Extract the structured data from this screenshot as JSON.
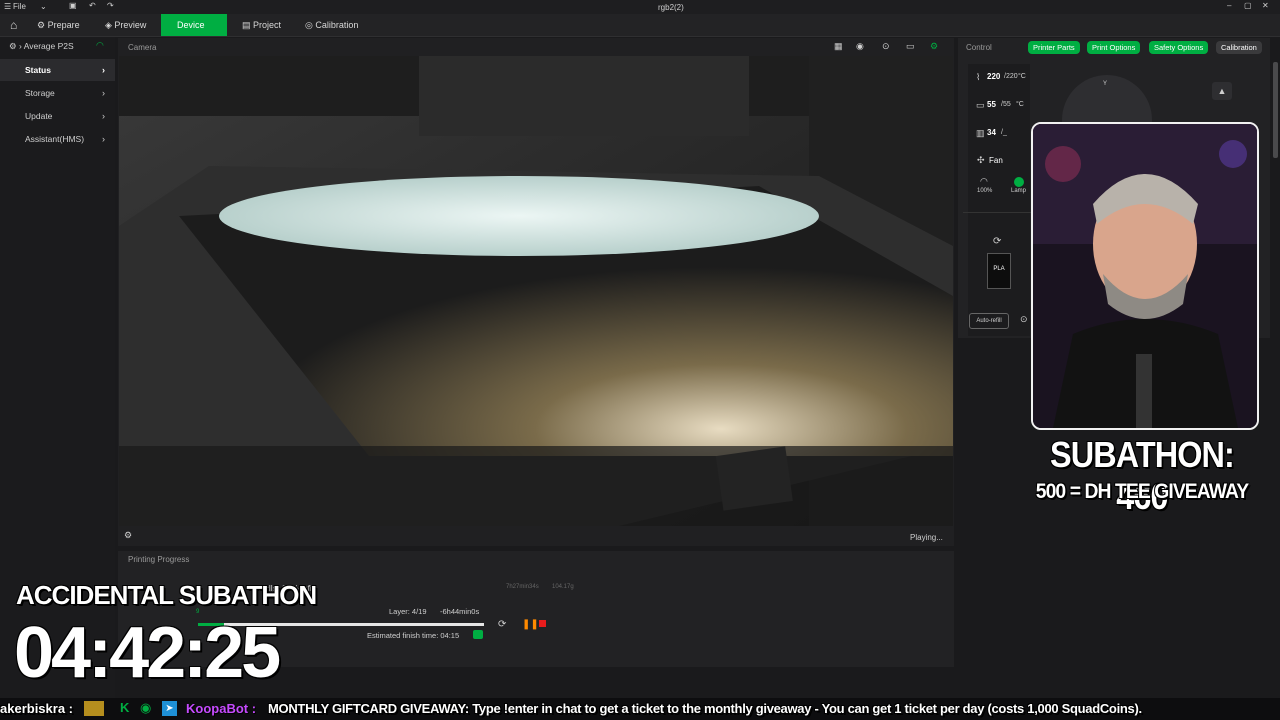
{
  "titlebar": {
    "file_menu": "File",
    "window_title": "rgb2(2)"
  },
  "tabs": [
    {
      "label": "Prepare"
    },
    {
      "label": "Preview"
    },
    {
      "label": "Device"
    },
    {
      "label": "Project"
    },
    {
      "label": "Calibration"
    }
  ],
  "sidebar": {
    "printer_name": "Average P2S",
    "items": [
      {
        "label": "Status"
      },
      {
        "label": "Storage"
      },
      {
        "label": "Update"
      },
      {
        "label": "Assistant(HMS)"
      }
    ]
  },
  "camera": {
    "title": "Camera",
    "status": "Playing..."
  },
  "progress": {
    "title": "Printing Progress",
    "job_info": "walls, 15% infill",
    "time_info": "7h27min34s",
    "weight_info": "104.17g",
    "layer": "Layer: 4/19",
    "remaining": "-6h44min0s",
    "finish_time": "Estimated finish time: 04:15",
    "percent": "9",
    "progress_fraction": 0.09
  },
  "control": {
    "title": "Control",
    "buttons": [
      "Printer Parts",
      "Print Options",
      "Safety Options",
      "Calibration"
    ],
    "nozzle_temp": "220",
    "nozzle_target": "/220",
    "bed_temp": "55",
    "bed_target": "/55",
    "chamber_temp": "34",
    "chamber_target": "/_",
    "unit": "°C",
    "fan_label": "Fan",
    "fan_speed": "100%",
    "lamp_label": "Lamp",
    "axis_label": "Y",
    "filament_type": "PLA",
    "auto_refill": "Auto-refill"
  },
  "stream": {
    "subathon_count": "SUBATHON: 460",
    "giveaway_goal": "500 = DH TEE GIVEAWAY",
    "timer_title": "ACCIDENTAL SUBATHON",
    "timer_value": "04:42:25",
    "ticker_user": "akerbiskra :",
    "ticker_bot": "KoopaBot :",
    "ticker_message": "MONTHLY GIFTCARD GIVEAWAY: Type !enter in chat to get a ticket to the monthly giveaway - You can get 1 ticket per day (costs 1,000 SquadCoins)."
  },
  "colors": {
    "accent": "#00ae42",
    "pause": "#ff8a00",
    "stop": "#e81c1c",
    "bot_name": "#c64bff"
  }
}
